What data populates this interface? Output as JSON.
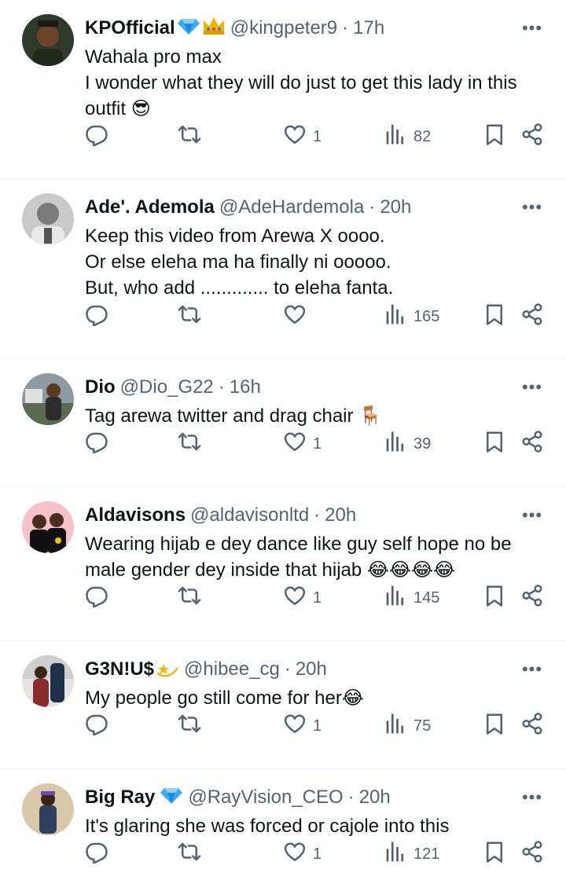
{
  "tweets": [
    {
      "name": "KPOfficial",
      "badges": [
        "diamond-icon",
        "crown-icon"
      ],
      "handle": "@kingpeter9",
      "dot": "·",
      "time": "17h",
      "lines": [
        "Wahala pro max",
        "I wonder what they will do just to get this lady in this",
        "outfit"
      ],
      "trailing_emoji": "😎",
      "likes": "1",
      "views": "82"
    },
    {
      "name": "Ade'. Ademola",
      "badges": [],
      "handle": "@AdeHardemola",
      "dot": "·",
      "time": "20h",
      "lines": [
        "Keep this video from Arewa X oooo.",
        "Or else eleha ma ha finally ni ooooo.",
        "But, who add ............. to eleha fanta."
      ],
      "trailing_emoji": "",
      "likes": "",
      "views": "165"
    },
    {
      "name": "Dio",
      "badges": [],
      "handle": "@Dio_G22",
      "dot": "·",
      "time": "16h",
      "lines": [
        "Tag arewa twitter and drag chair"
      ],
      "trailing_emoji": "🪑",
      "likes": "1",
      "views": "39"
    },
    {
      "name": "Aldavisons",
      "badges": [],
      "handle": "@aldavisonltd",
      "dot": "·",
      "time": "20h",
      "lines": [
        "Wearing hijab e dey dance like guy self hope no be",
        "male gender dey inside that hijab"
      ],
      "trailing_emoji": "😂😂😂😂",
      "likes": "1",
      "views": "145"
    },
    {
      "name": "G3N!U$",
      "badges": [
        "dizzy-star-icon"
      ],
      "handle": "@hibee_cg",
      "dot": "·",
      "time": "20h",
      "lines": [
        "My people go still come for her"
      ],
      "trailing_emoji": "😂",
      "likes": "1",
      "views": "75"
    },
    {
      "name": "Big Ray",
      "badges": [
        "diamond-icon"
      ],
      "handle": "@RayVision_CEO",
      "dot": "·",
      "time": "20h",
      "lines": [
        "It's glaring she was forced or cajole into this"
      ],
      "trailing_emoji": "",
      "likes": "1",
      "views": "121"
    }
  ],
  "more_label": "•••",
  "colors": {
    "text": "#0f1419",
    "secondary": "#536471",
    "divider": "#eff3f4",
    "diamond": "#3fa9f5",
    "crown": "#f5b400"
  }
}
